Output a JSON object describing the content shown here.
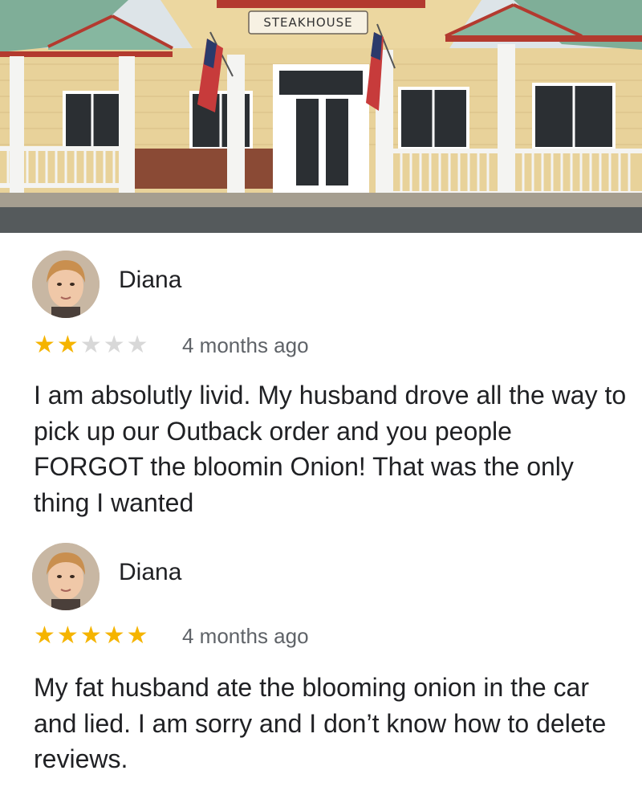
{
  "hero": {
    "sign_text": "STEAKHOUSE"
  },
  "colors": {
    "star_filled": "#f5b400",
    "star_empty": "#d8d8d8",
    "time_text": "#5f6368",
    "body_text": "#202124"
  },
  "reviews": [
    {
      "name": "Diana",
      "rating": 2,
      "max_rating": 5,
      "time": "4 months ago",
      "text": "I am absolutly livid. My husband drove all the way to pick up our Outback order and you people FORGOT the bloomin Onion! That was the only thing I wanted"
    },
    {
      "name": "Diana",
      "rating": 5,
      "max_rating": 5,
      "time": "4 months ago",
      "text": "My fat husband ate the blooming onion in the car and lied. I am sorry and I don’t know how to delete reviews."
    }
  ]
}
